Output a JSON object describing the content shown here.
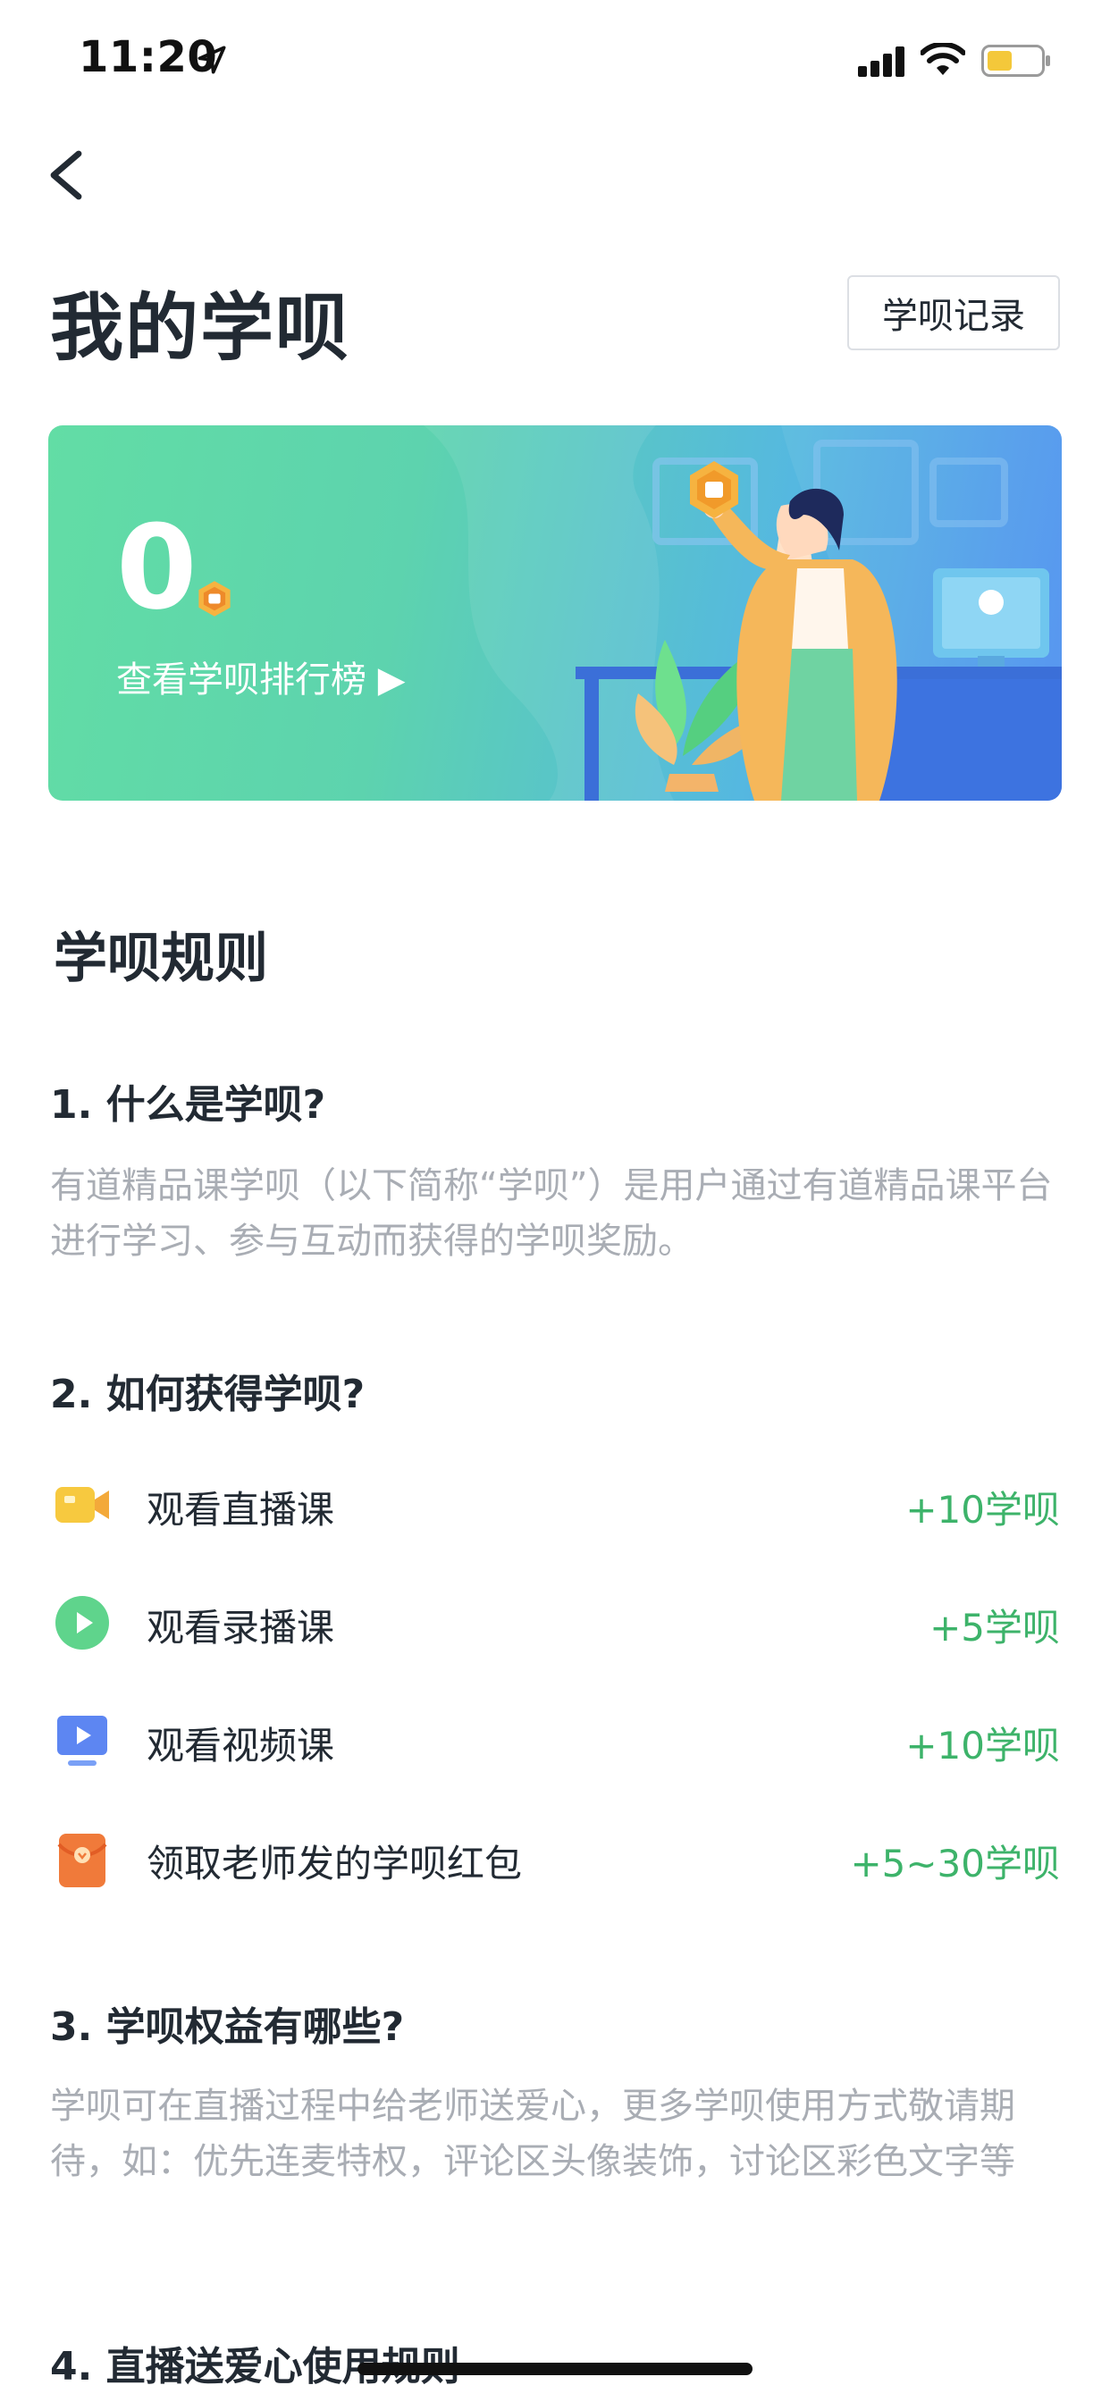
{
  "status": {
    "time": "11:20"
  },
  "header": {
    "title": "我的学呗",
    "record_button": "学呗记录"
  },
  "banner": {
    "points": "0",
    "rank_link": "查看学呗排行榜 ▶"
  },
  "rules": {
    "title": "学呗规则",
    "q1": {
      "heading": "1. 什么是学呗?",
      "text": "有道精品课学呗（以下简称“学呗”）是用户通过有道精品课平台进行学习、参与互动而获得的学呗奖励。"
    },
    "q2": {
      "heading": "2. 如何获得学呗?",
      "items": [
        {
          "icon": "video-camera-icon",
          "label": "观看直播课",
          "value": "+10学呗"
        },
        {
          "icon": "play-circle-icon",
          "label": "观看录播课",
          "value": "+5学呗"
        },
        {
          "icon": "monitor-play-icon",
          "label": "观看视频课",
          "value": "+10学呗"
        },
        {
          "icon": "red-envelope-icon",
          "label": "领取老师发的学呗红包",
          "value": "+5~30学呗"
        }
      ]
    },
    "q3": {
      "heading": "3. 学呗权益有哪些?",
      "text": "学呗可在直播过程中给老师送爱心，更多学呗使用方式敬请期待，如：优先连麦特权，评论区头像装饰，讨论区彩色文字等"
    },
    "q4": {
      "heading": "4. 直播送爱心使用规则"
    }
  },
  "colors": {
    "accent_green": "#3db36a",
    "banner_start": "#62dda5",
    "banner_end": "#4d8ef0"
  }
}
